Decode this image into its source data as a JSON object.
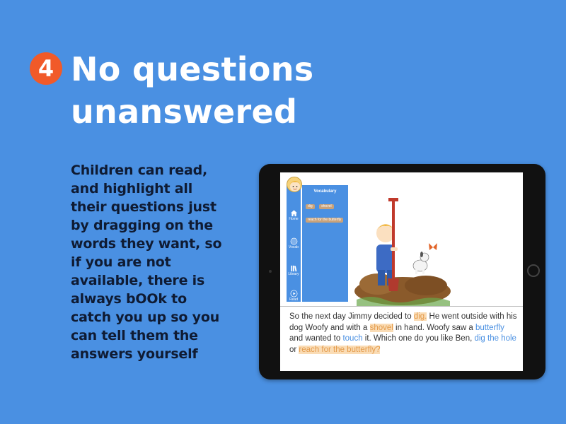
{
  "slide": {
    "number": "4",
    "title": "No questions unanswered",
    "body": "Children can read, and highlight all their questions just by dragging on the words they want, so if you are not available, there is always bOOk to catch you up so you can tell them the answers yourself"
  },
  "app": {
    "sidebar": {
      "items": [
        {
          "label": "Home",
          "icon": "home-icon"
        },
        {
          "label": "Vocab",
          "icon": "vocab-icon"
        },
        {
          "label": "Library",
          "icon": "library-icon"
        },
        {
          "label": "Read",
          "icon": "play-icon"
        }
      ]
    },
    "vocab_panel": {
      "title": "Vocabulary",
      "chips": [
        "dig",
        "shovel",
        "reach for the butterfly"
      ]
    },
    "story": {
      "segments": [
        {
          "text": "So the next day Jimmy decided to ",
          "style": "plain"
        },
        {
          "text": "dig.",
          "style": "orange"
        },
        {
          "text": " He went outside with his dog Woofy and with a ",
          "style": "plain"
        },
        {
          "text": "shovel",
          "style": "orange"
        },
        {
          "text": " in hand. Woofy saw a ",
          "style": "plain"
        },
        {
          "text": "butterfly",
          "style": "blue"
        },
        {
          "text": " and wanted to ",
          "style": "plain"
        },
        {
          "text": "touch",
          "style": "blue"
        },
        {
          "text": " it. Which one do you like Ben, ",
          "style": "plain"
        },
        {
          "text": "dig the hole",
          "style": "blue"
        },
        {
          "text": " or ",
          "style": "plain"
        },
        {
          "text": "reach for the butterfly?",
          "style": "orange"
        }
      ]
    }
  },
  "colors": {
    "background": "#4a90e2",
    "badge": "#f15a29",
    "highlight_orange": "#fadcb5",
    "highlight_blue": "#4a90e2"
  }
}
